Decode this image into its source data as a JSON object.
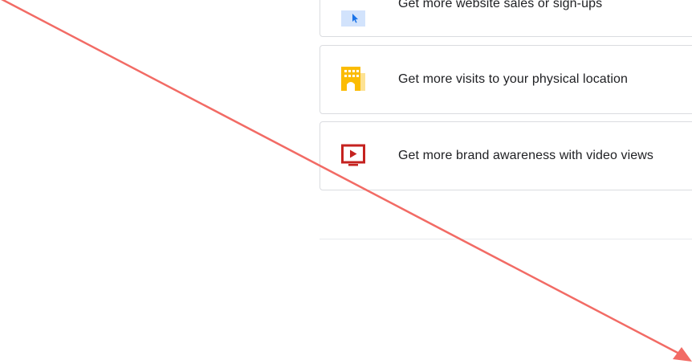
{
  "goals": [
    {
      "label": "Get more website sales or sign-ups",
      "icon": "cursor-click-icon"
    },
    {
      "label": "Get more visits to your physical location",
      "icon": "storefront-icon"
    },
    {
      "label": "Get more brand awareness with video views",
      "icon": "video-play-icon"
    }
  ],
  "colors": {
    "card_border": "#dadce0",
    "text": "#202124",
    "sales_icon_bg": "#d2e3fc",
    "location_icon": "#fbbc04",
    "video_icon": "#c5221f",
    "annotation_arrow": "#f26b65"
  },
  "annotation": {
    "icon": "arrow-annotation"
  }
}
